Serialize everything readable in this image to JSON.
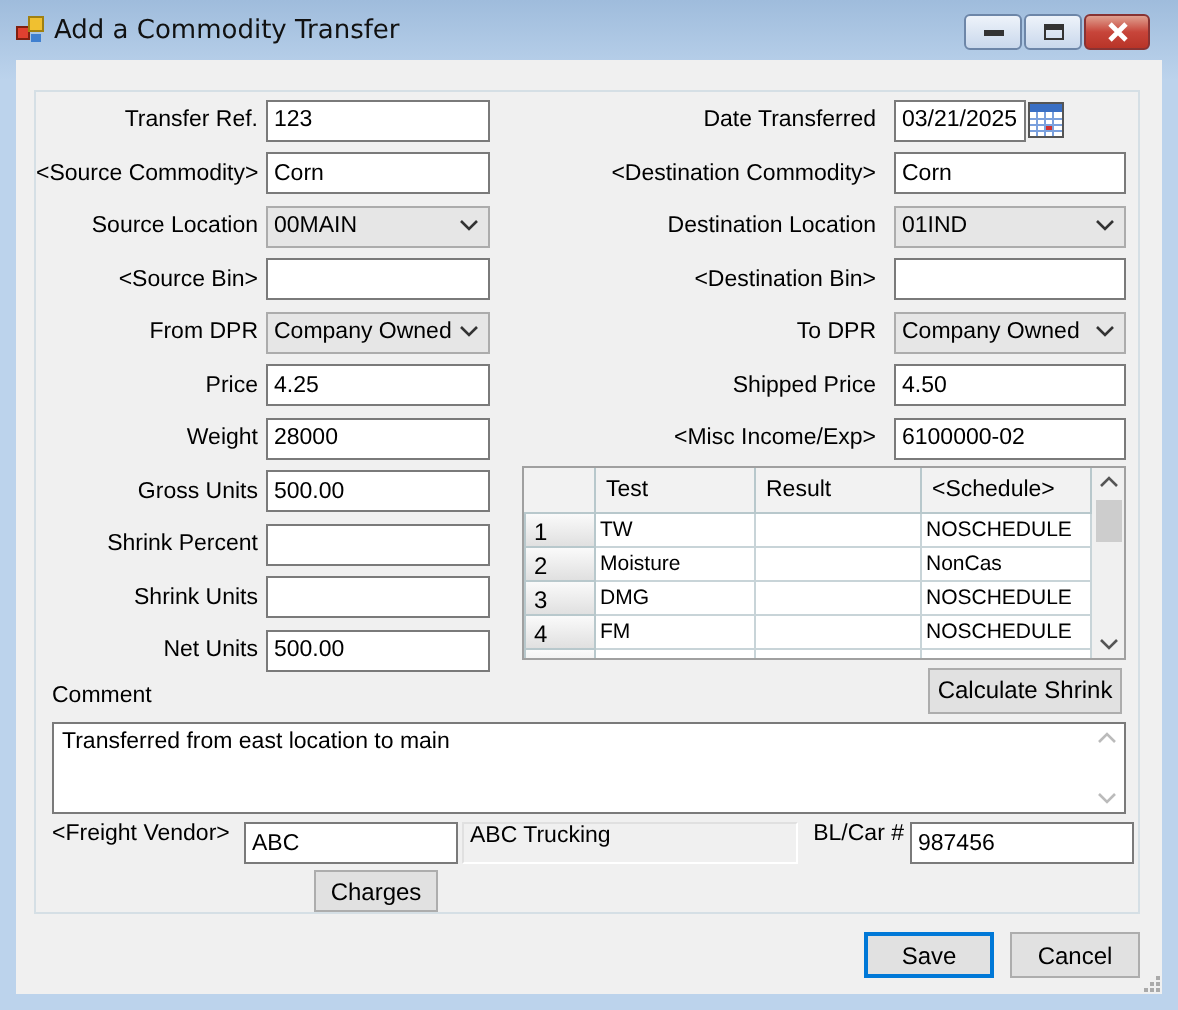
{
  "window": {
    "title": "Add a Commodity Transfer"
  },
  "left_fields": [
    {
      "label": "Transfer Ref.",
      "kind": "text",
      "value": "123"
    },
    {
      "label": "<Source Commodity>",
      "kind": "text",
      "value": "Corn"
    },
    {
      "label": "Source Location",
      "kind": "select",
      "value": "00MAIN"
    },
    {
      "label": "<Source Bin>",
      "kind": "text"
    },
    {
      "label": "From DPR",
      "kind": "select",
      "value": "Company Owned"
    },
    {
      "label": "Price",
      "kind": "text",
      "value": "4.25"
    },
    {
      "label": "Weight",
      "kind": "text",
      "value": "28000"
    },
    {
      "label": "Gross Units",
      "kind": "text",
      "value": "500.00"
    },
    {
      "label": "Shrink Percent",
      "kind": "text"
    },
    {
      "label": "Shrink Units",
      "kind": "text"
    },
    {
      "label": "Net Units",
      "kind": "text",
      "value": "500.00"
    }
  ],
  "right_fields": [
    {
      "label": "Date Transferred",
      "kind": "date",
      "value": "03/21/2025"
    },
    {
      "label": "<Destination Commodity>",
      "kind": "text",
      "value": "Corn"
    },
    {
      "label": "Destination Location",
      "kind": "select",
      "value": "01IND"
    },
    {
      "label": "<Destination Bin>",
      "kind": "text"
    },
    {
      "label": "To DPR",
      "kind": "select",
      "value": "Company Owned"
    },
    {
      "label": "Shipped Price",
      "kind": "text",
      "value": "4.50"
    },
    {
      "label": "<Misc Income/Exp>",
      "kind": "text",
      "value": "6100000-02"
    }
  ],
  "tests_table": {
    "columns": [
      "Test",
      "Result",
      "<Schedule>"
    ],
    "rows": [
      {
        "number": "1",
        "test": "TW",
        "schedule": "NOSCHEDULE"
      },
      {
        "number": "2",
        "test": "Moisture",
        "schedule": "NonCas"
      },
      {
        "number": "3",
        "test": "DMG",
        "schedule": "NOSCHEDULE"
      },
      {
        "number": "4",
        "test": "FM",
        "schedule": "NOSCHEDULE"
      }
    ]
  },
  "calculate_button": "Calculate Shrink",
  "comment": {
    "label": "Comment",
    "value": "Transferred from east location to main"
  },
  "freight": {
    "label": "<Freight Vendor>",
    "value": "ABC",
    "vendor_name": "ABC Trucking",
    "bl_label": "BL/Car #",
    "bl_value": "987456"
  },
  "charges_button": "Charges",
  "buttons": [
    {
      "label": "Save",
      "default": true
    },
    {
      "label": "Cancel",
      "default": false
    }
  ]
}
